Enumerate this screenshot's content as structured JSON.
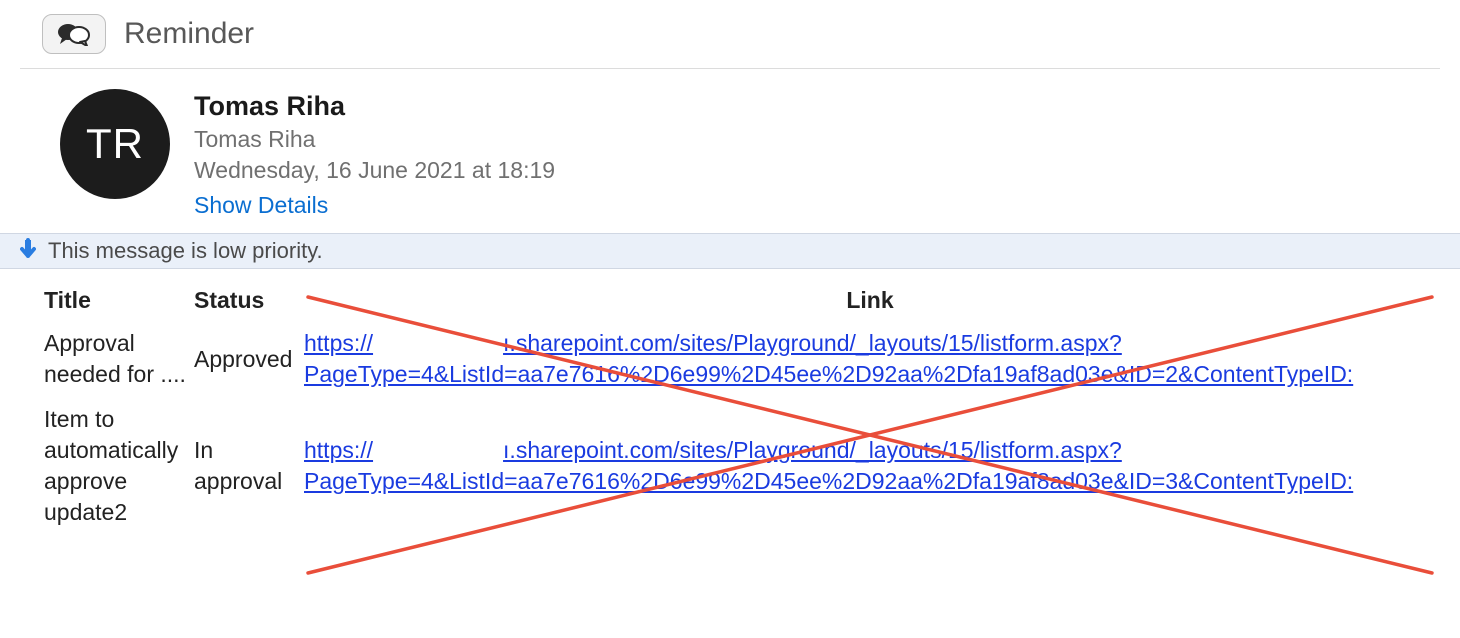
{
  "subject": "Reminder",
  "sender": {
    "initials": "TR",
    "name": "Tomas Riha",
    "subline": "Tomas Riha",
    "date": "Wednesday, 16 June 2021 at 18:19",
    "show_details": "Show Details"
  },
  "priority_notice": "This message is low priority.",
  "table": {
    "headers": {
      "title": "Title",
      "status": "Status",
      "link": "Link"
    },
    "rows": [
      {
        "title": "Approval needed for ....",
        "status": "Approved",
        "link_a": "https://",
        "link_b": "ı.sharepoint.com/sites/Playground/_layouts/15/listform.aspx?",
        "link_c": "PageType=4&ListId=aa7e7616%2D6e99%2D45ee%2D92aa%2Dfa19af8ad03e&ID=2&ContentTypeID:"
      },
      {
        "title": "Item to automatically approve update2",
        "status": "In approval",
        "link_a": "https://",
        "link_b": "ı.sharepoint.com/sites/Playground/_layouts/15/listform.aspx?",
        "link_c": "PageType=4&ListId=aa7e7616%2D6e99%2D45ee%2D92aa%2Dfa19af8ad03e&ID=3&ContentTypeID:"
      }
    ]
  }
}
